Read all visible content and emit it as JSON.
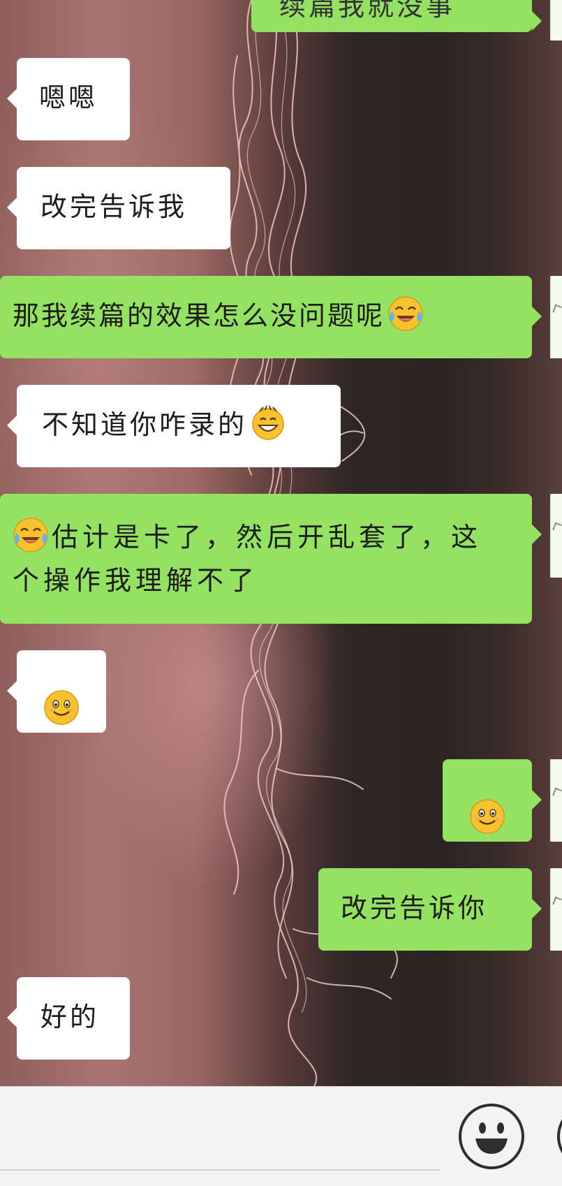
{
  "colors": {
    "incoming_bubble": "#ffffff",
    "outgoing_bubble": "#95e164",
    "input_bar": "#f4f4f4"
  },
  "messages": [
    {
      "id": "m0",
      "side": "out",
      "parts": [
        {
          "t": "text",
          "v": "续篇我就没事"
        }
      ]
    },
    {
      "id": "m1",
      "side": "in",
      "parts": [
        {
          "t": "text",
          "v": "嗯嗯"
        }
      ]
    },
    {
      "id": "m2",
      "side": "in",
      "parts": [
        {
          "t": "text",
          "v": "改完告诉我"
        }
      ]
    },
    {
      "id": "m3",
      "side": "out",
      "parts": [
        {
          "t": "text",
          "v": "那我续篇的效果怎么没问题呢"
        },
        {
          "t": "emoji",
          "v": "laughing-crying-emoji"
        }
      ]
    },
    {
      "id": "m4",
      "side": "in",
      "parts": [
        {
          "t": "text",
          "v": "不知道你咋录的"
        },
        {
          "t": "emoji",
          "v": "grinning-emoji"
        }
      ]
    },
    {
      "id": "m5",
      "side": "out",
      "parts": [
        {
          "t": "emoji",
          "v": "laughing-crying-emoji"
        },
        {
          "t": "text",
          "v": "估计是卡了，然后开乱套了，这个操作我理解不了"
        }
      ]
    },
    {
      "id": "m6",
      "side": "in",
      "parts": [
        {
          "t": "emoji",
          "v": "smile-emoji"
        }
      ]
    },
    {
      "id": "m7",
      "side": "out",
      "parts": [
        {
          "t": "emoji",
          "v": "smile-emoji"
        }
      ]
    },
    {
      "id": "m8",
      "side": "out",
      "parts": [
        {
          "t": "text",
          "v": "改完告诉你"
        }
      ]
    },
    {
      "id": "m9",
      "side": "in",
      "parts": [
        {
          "t": "text",
          "v": "好的"
        }
      ]
    }
  ],
  "input_bar": {
    "text_value": "",
    "emoji_button_icon": "emoji-face-icon",
    "more_button_icon": "plus-circle-icon"
  }
}
